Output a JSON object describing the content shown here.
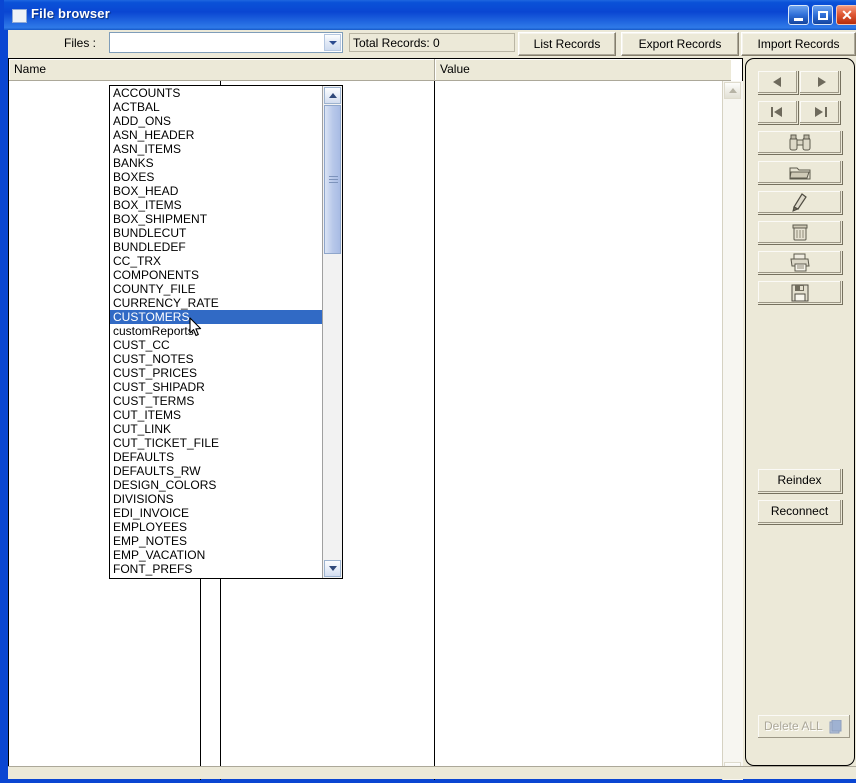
{
  "window": {
    "title": "File browser",
    "icon": "window-icon",
    "controls": {
      "minimize": "minimize",
      "maximize": "maximize",
      "close": "close"
    }
  },
  "toolbar": {
    "files_label": "Files :",
    "combo": {
      "value": "",
      "placeholder": ""
    },
    "total_records": "Total Records: 0",
    "list_records": "List Records",
    "export_records": "Export Records",
    "import_records": "Import Records"
  },
  "listview": {
    "columns": [
      "Name",
      "Value"
    ],
    "rows": []
  },
  "dropdown": {
    "selected": "CUSTOMERS",
    "items": [
      "ACCOUNTS",
      "ACTBAL",
      "ADD_ONS",
      "ASN_HEADER",
      "ASN_ITEMS",
      "BANKS",
      "BOXES",
      "BOX_HEAD",
      "BOX_ITEMS",
      "BOX_SHIPMENT",
      "BUNDLECUT",
      "BUNDLEDEF",
      "CC_TRX",
      "COMPONENTS",
      "COUNTY_FILE",
      "CURRENCY_RATE",
      "CUSTOMERS",
      "customReports",
      "CUST_CC",
      "CUST_NOTES",
      "CUST_PRICES",
      "CUST_SHIPADR",
      "CUST_TERMS",
      "CUT_ITEMS",
      "CUT_LINK",
      "CUT_TICKET_FILE",
      "DEFAULTS",
      "DEFAULTS_RW",
      "DESIGN_COLORS",
      "DIVISIONS",
      "EDI_INVOICE",
      "EMPLOYEES",
      "EMP_NOTES",
      "EMP_VACATION",
      "FONT_PREFS"
    ]
  },
  "side_panel": {
    "nav": {
      "prev": "previous-record",
      "next": "next-record",
      "first": "first-record",
      "last": "last-record"
    },
    "actions": [
      {
        "name": "find",
        "icon": "binoculars-icon"
      },
      {
        "name": "open",
        "icon": "folder-icon"
      },
      {
        "name": "edit",
        "icon": "pencil-icon"
      },
      {
        "name": "delete",
        "icon": "trash-icon"
      },
      {
        "name": "print",
        "icon": "printer-icon"
      },
      {
        "name": "save",
        "icon": "floppy-disk-icon"
      }
    ],
    "reindex": "Reindex",
    "reconnect": "Reconnect",
    "delete_all": "Delete ALL"
  },
  "statusbar": {
    "text": ""
  },
  "colors": {
    "title_bar": "#0a46d2",
    "face": "#ece9d8",
    "selection": "#316ac5",
    "close_button": "#b62d0c"
  }
}
